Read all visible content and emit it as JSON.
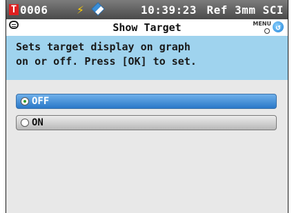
{
  "status_bar": {
    "target_icon_label": "T",
    "sample_id": "0006",
    "time": "10:39:23",
    "conditions": "Ref 3mm SCI"
  },
  "title_bar": {
    "title": "Show Target",
    "menu_label": "MENU"
  },
  "description": {
    "line1": "Sets target display on graph",
    "line2": "on or off. Press [OK] to set."
  },
  "options": [
    {
      "label": "OFF",
      "selected": true
    },
    {
      "label": "ON",
      "selected": false
    }
  ],
  "colors": {
    "status_bar": "#5a5a5a",
    "description_bg": "#9fd3ee",
    "selected_option": "#3a88d8",
    "target_icon": "#e02020"
  }
}
